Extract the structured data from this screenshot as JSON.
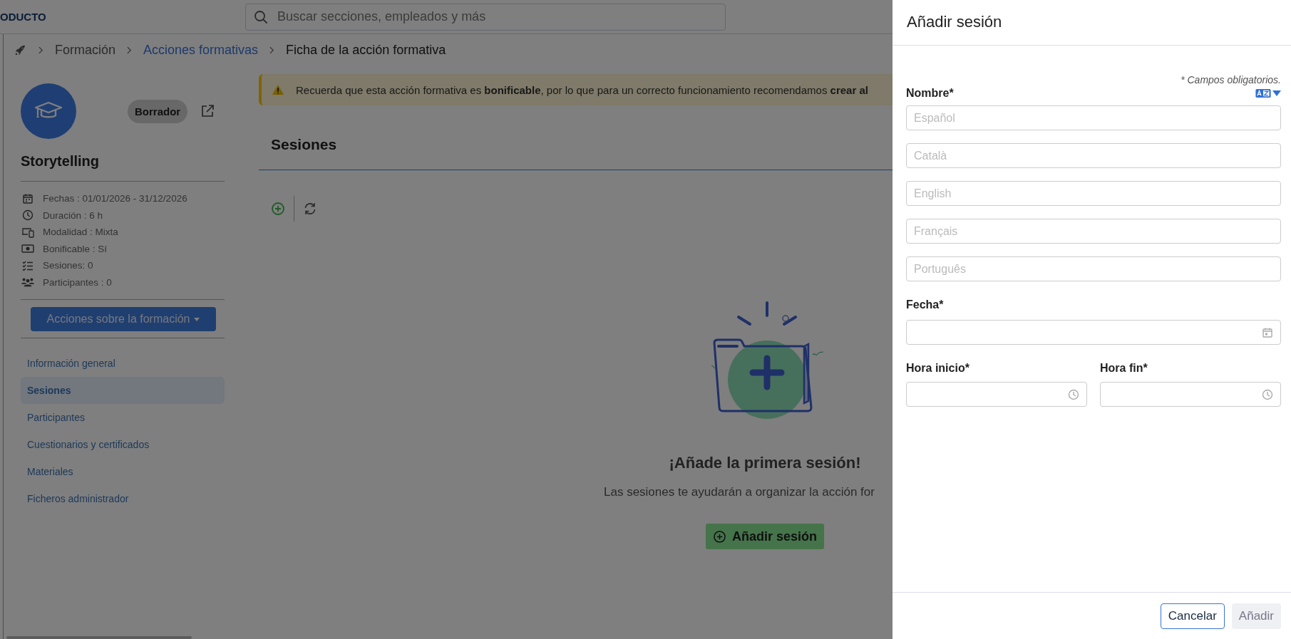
{
  "header": {
    "brand": "ODUCTO",
    "search": {
      "placeholder": "Buscar secciones, empleados y más"
    }
  },
  "breadcrumb": [
    {
      "label": "Formación",
      "kind": "plain"
    },
    {
      "label": "Acciones formativas",
      "kind": "link"
    },
    {
      "label": "Ficha de la acción formativa",
      "kind": "current"
    }
  ],
  "course": {
    "title": "Storytelling",
    "status": "Borrador",
    "actions_button": "Acciones sobre la formación",
    "info": [
      {
        "kind": "calendar",
        "text": "Fechas : 01/01/2026 - 31/12/2026"
      },
      {
        "kind": "clock",
        "text": "Duración : 6 h"
      },
      {
        "kind": "devices",
        "text": "Modalidad : Mixta"
      },
      {
        "kind": "money",
        "text": "Bonificable : Sí"
      },
      {
        "kind": "list",
        "text": "Sesiones: 0"
      },
      {
        "kind": "people",
        "text": "Participantes : 0"
      }
    ]
  },
  "nav": [
    {
      "label": "Información general",
      "selected": false
    },
    {
      "label": "Sesiones",
      "selected": true
    },
    {
      "label": "Participantes",
      "selected": false
    },
    {
      "label": "Cuestionarios y certificados",
      "selected": false
    },
    {
      "label": "Materiales",
      "selected": false
    },
    {
      "label": "Ficheros administrador",
      "selected": false
    }
  ],
  "alert": {
    "text": "Recuerda que esta acción formativa es **bonificable**, por lo que para un correcto funcionamiento recomendamos **crear al**"
  },
  "section": {
    "title": "Sesiones",
    "empty_title": "¡Añade la primera sesión!",
    "empty_text": "Las sesiones te ayudarán a organizar la acción for",
    "add_button": "Añadir sesión"
  },
  "drawer": {
    "title": "Añadir sesión",
    "required_note": "* Campos obligatorios.",
    "name_label": "Nombre*",
    "name_fields": [
      {
        "placeholder": "Español"
      },
      {
        "placeholder": "Català"
      },
      {
        "placeholder": "English"
      },
      {
        "placeholder": "Français"
      },
      {
        "placeholder": "Português"
      }
    ],
    "date_label": "Fecha*",
    "start_label": "Hora inicio*",
    "end_label": "Hora fin*",
    "cancel": "Cancelar",
    "submit": {
      "label": "Añadir",
      "disabled": true
    }
  }
}
